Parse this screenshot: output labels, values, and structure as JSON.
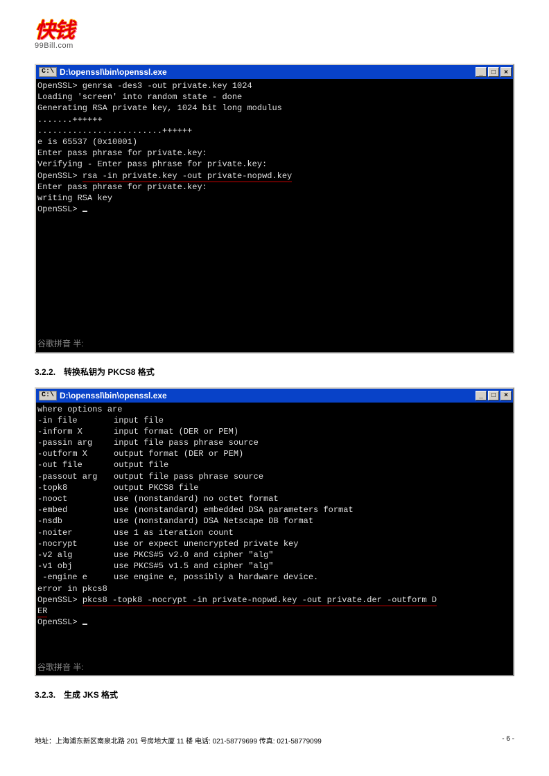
{
  "logo": {
    "main": "快钱",
    "sub": "99Bill.com"
  },
  "terminals": {
    "t1": {
      "title": "D:\\openssl\\bin\\openssl.exe",
      "lines": [
        "OpenSSL> genrsa -des3 -out private.key 1024",
        "Loading 'screen' into random state - done",
        "Generating RSA private key, 1024 bit long modulus",
        ".......++++++",
        ".........................++++++",
        "e is 65537 (0x10001)",
        "Enter pass phrase for private.key:",
        "Verifying - Enter pass phrase for private.key:"
      ],
      "cmd_prefix": "OpenSSL> ",
      "cmd_underlined": "rsa -in private.key -out private-nopwd.key",
      "lines_after": [
        "Enter pass phrase for private.key:",
        "writing RSA key"
      ],
      "prompt": "OpenSSL> ",
      "ime": "谷歌拼音 半:"
    },
    "t2": {
      "title": "D:\\openssl\\bin\\openssl.exe",
      "pre": "where options are",
      "options": [
        [
          "-in file",
          "input file"
        ],
        [
          "-inform X",
          "input format (DER or PEM)"
        ],
        [
          "-passin arg",
          "input file pass phrase source"
        ],
        [
          "-outform X",
          "output format (DER or PEM)"
        ],
        [
          "-out file",
          "output file"
        ],
        [
          "-passout arg",
          "output file pass phrase source"
        ],
        [
          "-topk8",
          "output PKCS8 file"
        ],
        [
          "-nooct",
          "use (nonstandard) no octet format"
        ],
        [
          "-embed",
          "use (nonstandard) embedded DSA parameters format"
        ],
        [
          "-nsdb",
          "use (nonstandard) DSA Netscape DB format"
        ],
        [
          "-noiter",
          "use 1 as iteration count"
        ],
        [
          "-nocrypt",
          "use or expect unencrypted private key"
        ],
        [
          "-v2 alg",
          "use PKCS#5 v2.0 and cipher \"alg\""
        ],
        [
          "-v1 obj",
          "use PKCS#5 v1.5 and cipher \"alg\""
        ],
        [
          " -engine e",
          "use engine e, possibly a hardware device."
        ]
      ],
      "error": "error in pkcs8",
      "cmd_prefix": "OpenSSL> ",
      "cmd_underlined": "pkcs8 -topk8 -nocrypt -in private-nopwd.key -out private.der -outform D",
      "cmd_wrap": "ER",
      "prompt": "OpenSSL> ",
      "ime": "谷歌拼音 半:"
    }
  },
  "sections": {
    "s1": "3.2.2.　转换私钥为 PKCS8 格式",
    "s2": "3.2.3.　生成 JKS 格式"
  },
  "winbtns": {
    "min": "_",
    "max": "□",
    "close": "×"
  },
  "window_icon": "C:\\",
  "footer": {
    "address": "地址：上海浦东新区南泉北路 201 号房地大厦 11 楼 电话: 021-58779699 传真: 021-58779099",
    "page": "- 6 -"
  }
}
